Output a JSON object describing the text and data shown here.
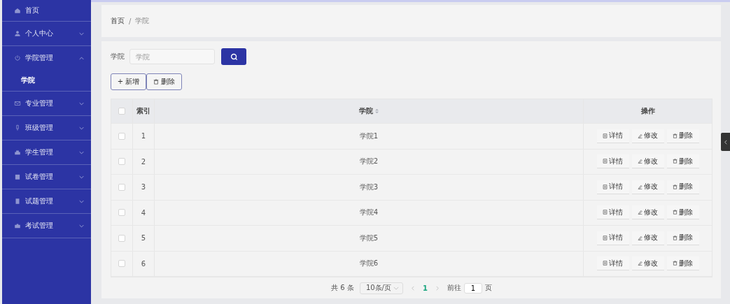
{
  "sidebar": {
    "items": [
      {
        "label": "首页",
        "kind": "link"
      },
      {
        "label": "个人中心",
        "kind": "group",
        "expanded": false
      },
      {
        "label": "学院管理",
        "kind": "group",
        "expanded": true,
        "children": [
          {
            "label": "学院",
            "selected": true
          }
        ]
      },
      {
        "label": "专业管理",
        "kind": "group",
        "expanded": false
      },
      {
        "label": "班级管理",
        "kind": "group",
        "expanded": false
      },
      {
        "label": "学生管理",
        "kind": "group",
        "expanded": false
      },
      {
        "label": "试卷管理",
        "kind": "group",
        "expanded": false
      },
      {
        "label": "试题管理",
        "kind": "group",
        "expanded": false
      },
      {
        "label": "考试管理",
        "kind": "group",
        "expanded": false
      }
    ]
  },
  "breadcrumb": {
    "items": [
      "首页",
      "学院"
    ],
    "separator": "/"
  },
  "search": {
    "label": "学院",
    "placeholder": "学院"
  },
  "actions": {
    "add_icon": "+",
    "add": "新增",
    "delete": "删除"
  },
  "table": {
    "columns": [
      "索引",
      "学院",
      "操作"
    ],
    "all_checked": false,
    "rows": [
      {
        "index": "1",
        "name": "学院1",
        "checked": false,
        "actions": [
          "详情",
          "修改",
          "删除"
        ]
      },
      {
        "index": "2",
        "name": "学院2",
        "checked": false,
        "actions": [
          "详情",
          "修改",
          "删除"
        ]
      },
      {
        "index": "3",
        "name": "学院3",
        "checked": false,
        "actions": [
          "详情",
          "修改",
          "删除"
        ]
      },
      {
        "index": "4",
        "name": "学院4",
        "checked": false,
        "actions": [
          "详情",
          "修改",
          "删除"
        ]
      },
      {
        "index": "5",
        "name": "学院5",
        "checked": false,
        "actions": [
          "详情",
          "修改",
          "删除"
        ]
      },
      {
        "index": "6",
        "name": "学院6",
        "checked": false,
        "actions": [
          "详情",
          "修改",
          "删除"
        ]
      }
    ]
  },
  "pagination": {
    "total": "共 6 条",
    "page_size": "10条/页",
    "pages": [
      {
        "label": "1",
        "selected": true
      }
    ],
    "goto_label": "前往",
    "goto_value": "1",
    "page_suffix": "页"
  }
}
